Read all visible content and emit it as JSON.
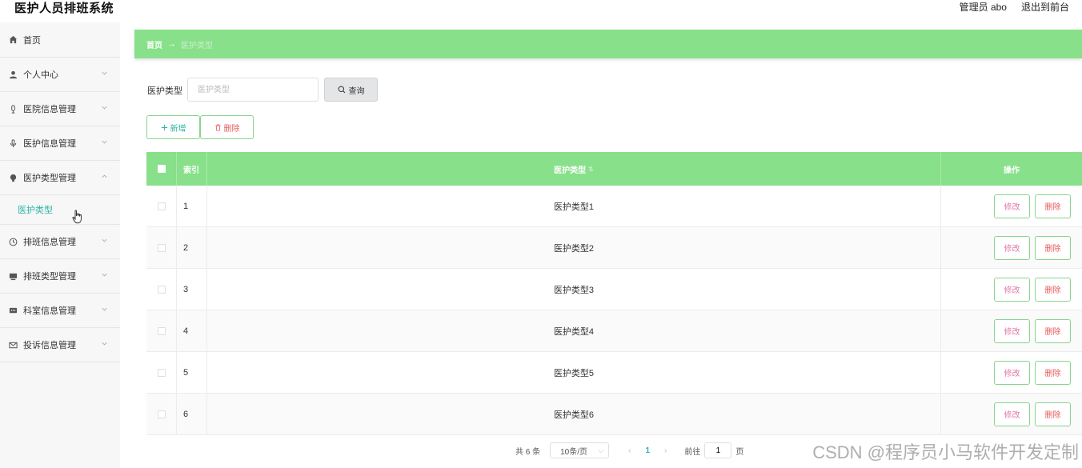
{
  "header": {
    "title": "医护人员排班系统",
    "user": "管理员 abo",
    "logout": "退出到前台"
  },
  "sidebar": {
    "items": [
      {
        "label": "首页",
        "icon": "home-icon"
      },
      {
        "label": "个人中心",
        "icon": "user-icon"
      },
      {
        "label": "医院信息管理",
        "icon": "mic-icon"
      },
      {
        "label": "医护信息管理",
        "icon": "mic-icon"
      },
      {
        "label": "医护类型管理",
        "icon": "bulb-icon"
      },
      {
        "label": "排班信息管理",
        "icon": "clock-icon"
      },
      {
        "label": "排班类型管理",
        "icon": "monitor-icon"
      },
      {
        "label": "科室信息管理",
        "icon": "chat-icon"
      },
      {
        "label": "投诉信息管理",
        "icon": "mail-icon"
      }
    ],
    "sub_item": "医护类型"
  },
  "breadcrumb": {
    "home": "首页",
    "arrow": "→",
    "current": "医护类型"
  },
  "search": {
    "label": "医护类型",
    "placeholder": "医护类型",
    "value": "",
    "query_button": "查询"
  },
  "actions": {
    "add": "新增",
    "delete": "删除"
  },
  "table": {
    "headers": {
      "index": "索引",
      "type": "医护类型",
      "ops": "操作"
    },
    "rows": [
      {
        "index": "1",
        "type": "医护类型1"
      },
      {
        "index": "2",
        "type": "医护类型2"
      },
      {
        "index": "3",
        "type": "医护类型3"
      },
      {
        "index": "4",
        "type": "医护类型4"
      },
      {
        "index": "5",
        "type": "医护类型5"
      },
      {
        "index": "6",
        "type": "医护类型6"
      }
    ],
    "edit_label": "修改",
    "delete_label": "删除"
  },
  "pagination": {
    "total": "共 6 条",
    "page_size": "10条/页",
    "current_page": "1",
    "goto_label": "前往",
    "goto_value": "1",
    "page_suffix": "页"
  },
  "watermark": "CSDN @程序员小马软件开发定制",
  "colors": {
    "accent_green": "#88e08a",
    "teal": "#2bb3a3",
    "danger": "#e65a5a"
  }
}
